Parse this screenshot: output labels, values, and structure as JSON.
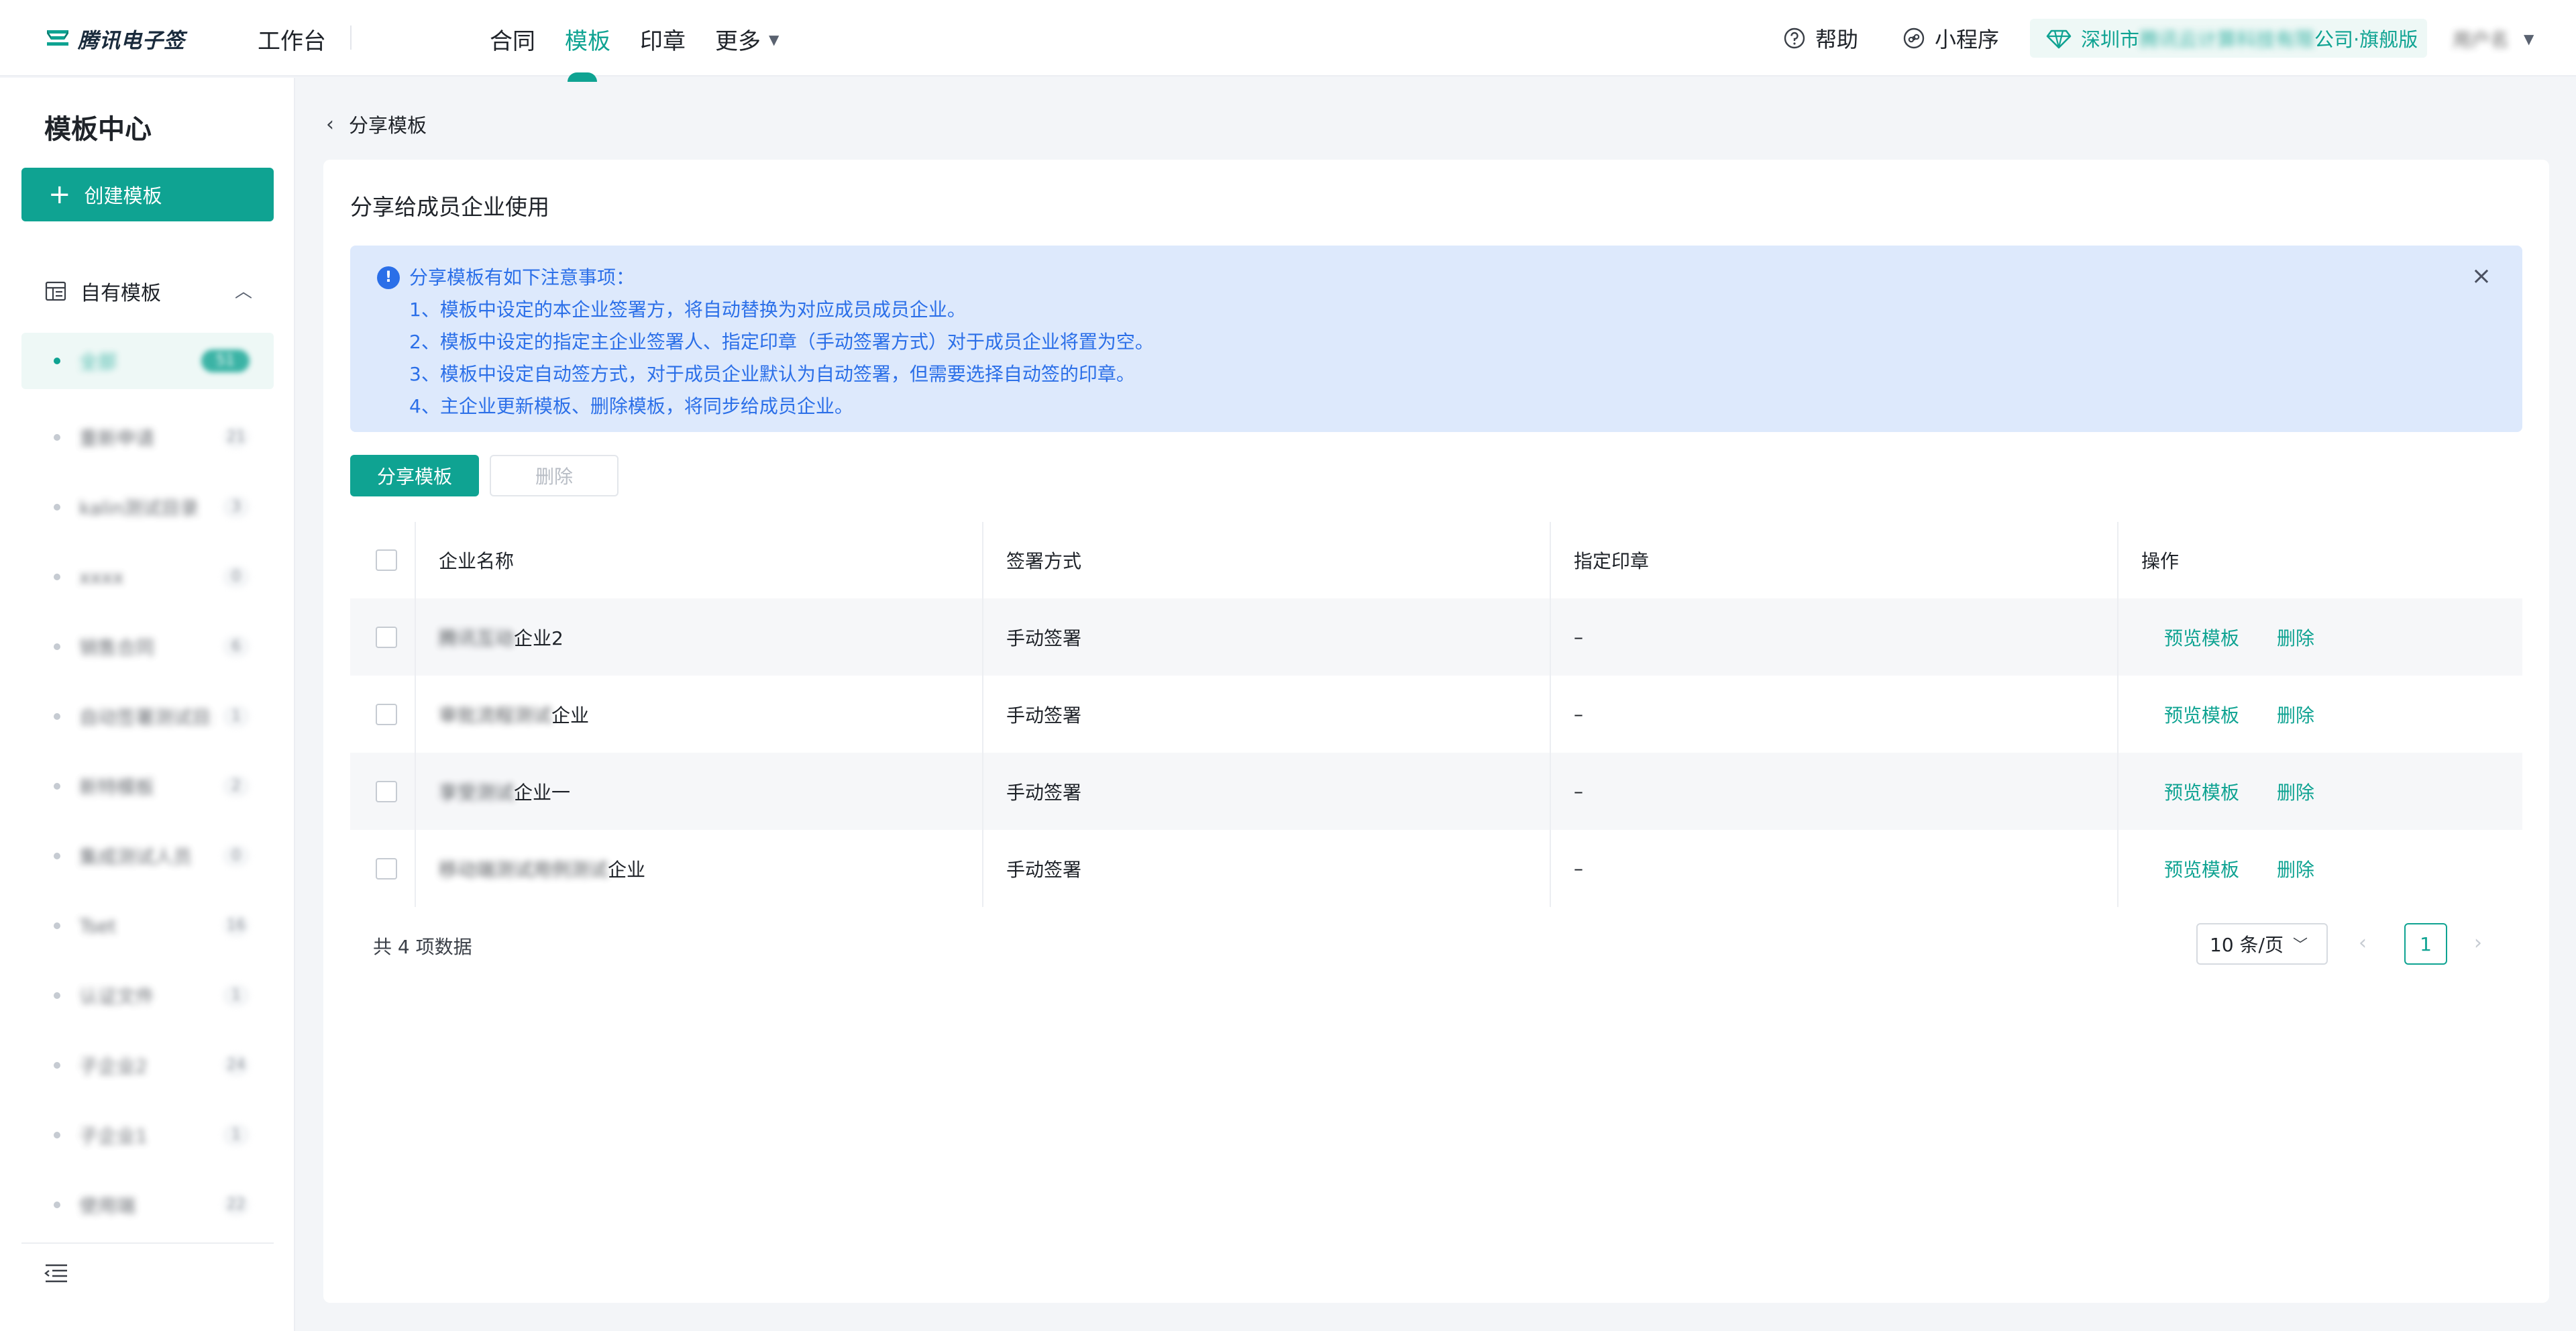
{
  "header": {
    "logo_text": "腾讯电子签",
    "workbench": "工作台",
    "nav": [
      {
        "label": "合同",
        "active": false
      },
      {
        "label": "模板",
        "active": true
      },
      {
        "label": "印章",
        "active": false
      }
    ],
    "more_label": "更多",
    "help_label": "帮助",
    "miniprogram_label": "小程序",
    "org_prefix": "深圳市",
    "org_suffix": "公司·旗舰版",
    "user_name": "用户名"
  },
  "sidebar": {
    "title": "模板中心",
    "create_button": "创建模板",
    "group_label": "自有模板",
    "items": [
      {
        "label": "全部",
        "count": "51",
        "active": true
      },
      {
        "label": "重新申请",
        "count": "21"
      },
      {
        "label": "kalin测试目录",
        "count": "3"
      },
      {
        "label": "xxxx",
        "count": "0"
      },
      {
        "label": "销售合同",
        "count": "6"
      },
      {
        "label": "自动签署测试目录",
        "count": "1"
      },
      {
        "label": "新特模板",
        "count": "2"
      },
      {
        "label": "集成测试人员",
        "count": "0"
      },
      {
        "label": "Tset",
        "count": "16"
      },
      {
        "label": "认证文件",
        "count": "1"
      },
      {
        "label": "子企业2",
        "count": "24"
      },
      {
        "label": "子企业1",
        "count": "1"
      },
      {
        "label": "使用端",
        "count": "22"
      }
    ]
  },
  "main": {
    "back_label": "分享模板",
    "card_title": "分享给成员企业使用",
    "notice": {
      "title": "分享模板有如下注意事项：",
      "lines": [
        "1、模板中设定的本企业签署方，将自动替换为对应成员成员企业。",
        "2、模板中设定的指定主企业签署人、指定印章（手动签署方式）对于成员企业将置为空。",
        "3、模板中设定自动签方式，对于成员企业默认为自动签署，但需要选择自动签的印章。",
        "4、主企业更新模板、删除模板，将同步给成员企业。"
      ]
    },
    "share_button": "分享模板",
    "delete_button": "删除",
    "table": {
      "headers": [
        "企业名称",
        "签署方式",
        "指定印章",
        "操作"
      ],
      "rows": [
        {
          "name_hidden": "腾讯互动",
          "name_visible": "企业2",
          "sign": "手动签署",
          "seal": "–",
          "op_preview": "预览模板",
          "op_delete": "删除"
        },
        {
          "name_hidden": "审批流程测试",
          "name_visible": "企业",
          "sign": "手动签署",
          "seal": "–",
          "op_preview": "预览模板",
          "op_delete": "删除"
        },
        {
          "name_hidden": "享受测试",
          "name_visible": "企业一",
          "sign": "手动签署",
          "seal": "–",
          "op_preview": "预览模板",
          "op_delete": "删除"
        },
        {
          "name_hidden": "移动端测试用例测试",
          "name_visible": "企业",
          "sign": "手动签署",
          "seal": "–",
          "op_preview": "预览模板",
          "op_delete": "删除"
        }
      ]
    },
    "footer": {
      "total": "共 4 项数据",
      "page_size": "10 条/页",
      "current_page": "1"
    }
  },
  "colors": {
    "accent": "#0fa392",
    "notice_bg": "#dde9fc",
    "notice_text": "#2b6fe8"
  }
}
